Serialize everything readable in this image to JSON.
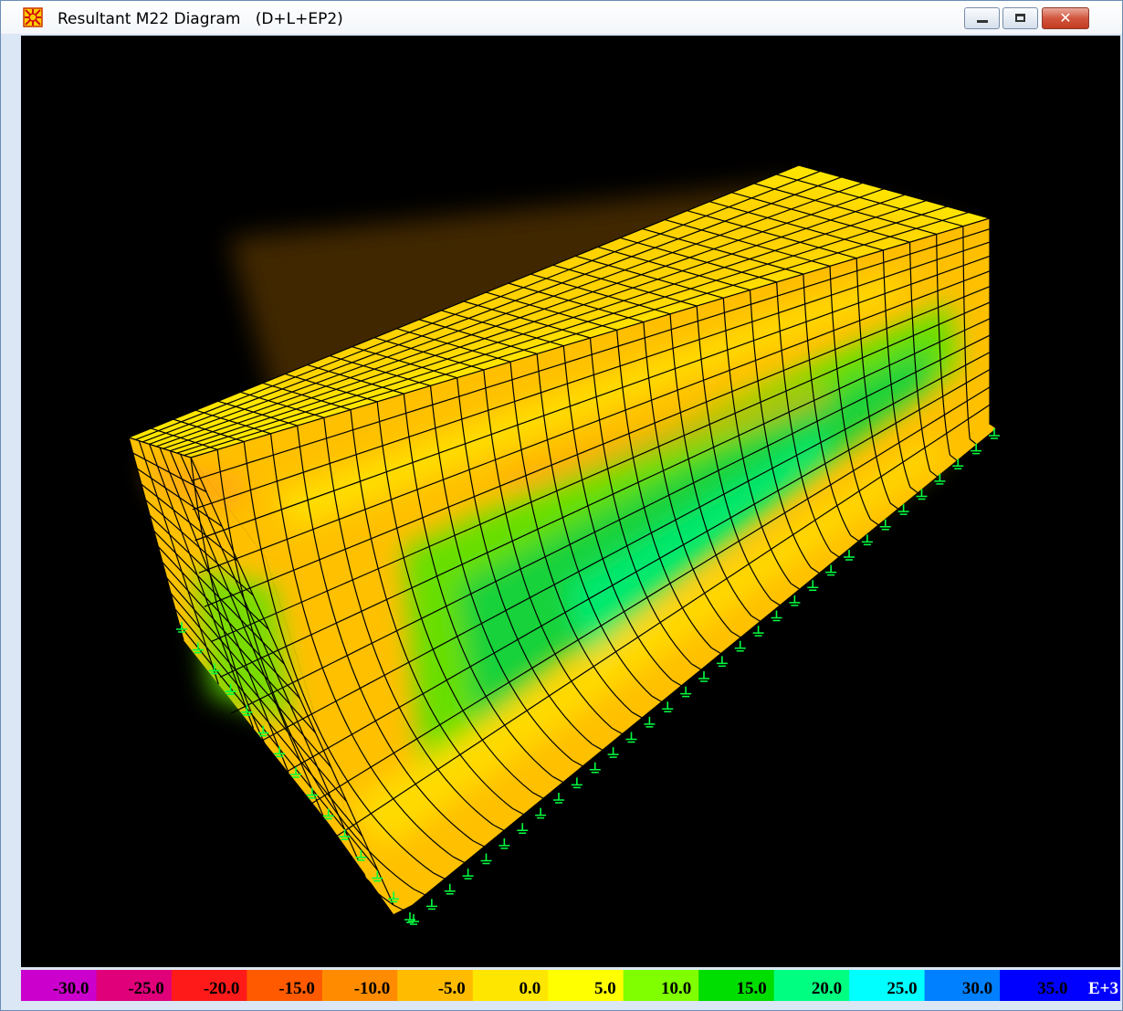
{
  "window": {
    "title": "Resultant M22 Diagram   (D+L+EP2)",
    "app_icon": "sap-model-icon",
    "controls": {
      "minimize": "minimize-icon",
      "maximize": "maximize-icon",
      "close": "close-icon",
      "close_glyph": "✕"
    }
  },
  "legend": {
    "labels": [
      "-30.0",
      "-25.0",
      "-20.0",
      "-15.0",
      "-10.0",
      "-5.0",
      "0.0",
      "5.0",
      "10.0",
      "15.0",
      "20.0",
      "25.0",
      "30.0",
      "35.0"
    ],
    "colors": [
      "#cc00cc",
      "#e0007a",
      "#ff1a1a",
      "#ff5a00",
      "#ff8c00",
      "#ffbb00",
      "#ffe600",
      "#ffff00",
      "#80ff00",
      "#00dd00",
      "#00ff80",
      "#00ffff",
      "#0080ff",
      "#0000ff"
    ],
    "exponent": "E+3"
  },
  "model": {
    "palette": {
      "wall_base": "#ffc000",
      "light": "#ffe600",
      "orange": "#ff9c10",
      "green": "#60e000",
      "green_deep": "#10d040",
      "cyan_green": "#00f080",
      "mesh_line": "#000000",
      "support": "#00ff40"
    }
  }
}
